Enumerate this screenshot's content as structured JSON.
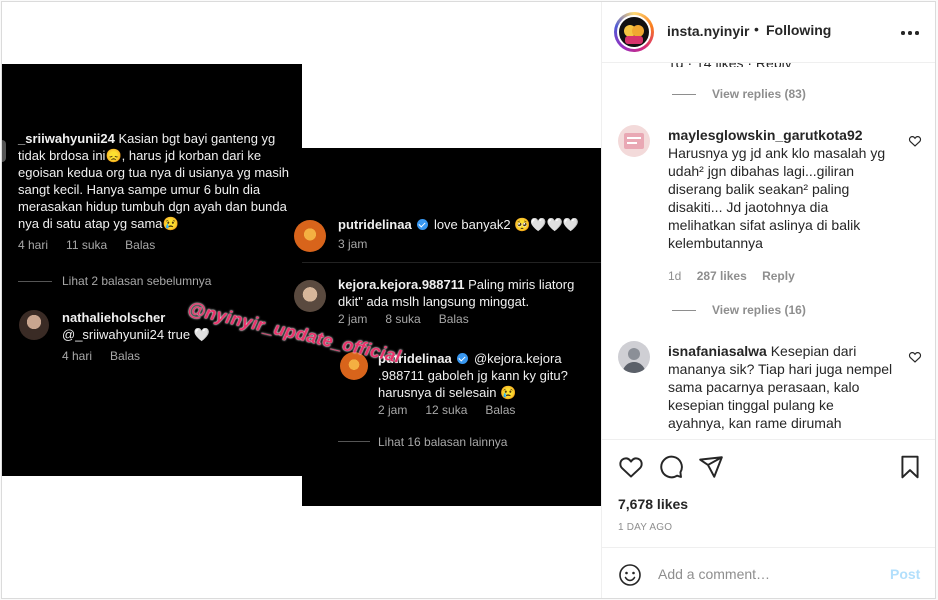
{
  "header": {
    "username": "insta.nyinyir",
    "separator": "•",
    "follow_status": "Following"
  },
  "media": {
    "watermark": "@nyinyir_update_official",
    "shot1": {
      "comment1": {
        "username": "_sriiwahyunii24",
        "text": "Kasian bgt bayi ganteng yg tidak brdosa ini😞, harus jd korban dari ke egoisan kedua org tua nya di usianya yg masih sangt kecil. Hanya sampe umur 6 buln dia merasakan hidup tumbuh dgn ayah dan bunda nya di satu atap yg sama😢",
        "time": "4 hari",
        "likes": "11 suka",
        "reply": "Balas"
      },
      "view_more": "Lihat 2 balasan sebelumnya",
      "comment2": {
        "username": "nathalieholscher",
        "text": "@_sriiwahyunii24 true 🤍",
        "time": "4 hari",
        "reply": "Balas"
      }
    },
    "shot2": {
      "comment1": {
        "username": "putridelinaa",
        "text": "love banyak2 🥺🤍🤍🤍",
        "time": "3 jam"
      },
      "comment2": {
        "username": "kejora.kejora.988711",
        "text": "Paling miris liatorg dkit\" ada mslh langsung minggat.",
        "time": "2 jam",
        "likes": "8 suka",
        "reply": "Balas"
      },
      "comment3": {
        "username": "putridelinaa",
        "text": "@kejora.kejora .988711 gaboleh jg kann ky gitu? harusnya di selesain 😢",
        "time": "2 jam",
        "likes": "12 suka",
        "reply": "Balas"
      },
      "view_more": "Lihat 16 balasan lainnya"
    }
  },
  "comments": {
    "view_replies_1": "View replies (83)",
    "c1": {
      "username": "maylesglowskin_garutkota92",
      "text": "Harusnya yg jd ank klo masalah yg udah² jgn dibahas lagi...giliran diserang balik seakan² paling disakiti... Jd jaotohnya dia melihatkan sifat aslinya di balik kelembutannya",
      "time": "1d",
      "likes": "287 likes",
      "reply": "Reply"
    },
    "view_replies_2": "View replies (16)",
    "c2": {
      "username": "isnafaniasalwa",
      "text": "Kesepian dari mananya sik? Tiap hari juga nempel sama pacarnya perasaan, kalo kesepian tinggal pulang ke ayahnya, kan rame dirumah"
    }
  },
  "actions": {
    "likes": "7,678 likes",
    "time_ago": "1 DAY AGO"
  },
  "add_comment": {
    "placeholder": "Add a comment…",
    "post_label": "Post"
  },
  "colors": {
    "accent": "#0095f6",
    "post_disabled": "#b2dffc",
    "watermark": "#e8336b"
  }
}
